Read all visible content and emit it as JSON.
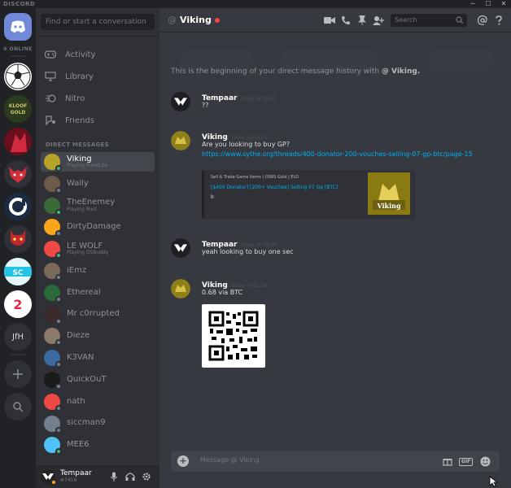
{
  "app": {
    "brand": "DISCORD"
  },
  "window": {
    "minimize": "─",
    "maximize": "☐",
    "close": "✕"
  },
  "rail": {
    "online_label": "0 ONLINE",
    "home_icon": "discord-logo-icon",
    "servers": [
      {
        "name": "server-ball",
        "color": "#ffffff"
      },
      {
        "name": "server-kloofgold",
        "color": "#2c3a1f"
      },
      {
        "name": "server-red-char",
        "color": "#a0152a"
      },
      {
        "name": "server-fox",
        "color": "#c0283a"
      },
      {
        "name": "server-ring",
        "color": "#1f6fc0"
      },
      {
        "name": "server-devil",
        "color": "#8b1a1a"
      },
      {
        "name": "server-sc",
        "color": "#22c3e6"
      },
      {
        "name": "server-two",
        "color": "#e6294b"
      }
    ],
    "text_server": "JfH",
    "add_icon": "plus-icon",
    "explore_icon": "search-icon"
  },
  "sidebar": {
    "search_placeholder": "Find or start a conversation",
    "nav": [
      {
        "label": "Activity",
        "icon": "gamepad-icon"
      },
      {
        "label": "Library",
        "icon": "library-icon"
      },
      {
        "label": "Nitro",
        "icon": "nitro-icon"
      },
      {
        "label": "Friends",
        "icon": "friends-icon"
      }
    ],
    "dm_header": "DIRECT MESSAGES",
    "dms": [
      {
        "name": "Viking",
        "sub": "Playing RuneLite",
        "color": "#b8a32a",
        "status": "#43b581",
        "active": true
      },
      {
        "name": "Wally",
        "sub": "",
        "color": "#6d5a4a",
        "status": "#747f8d"
      },
      {
        "name": "TheEnemey",
        "sub": "Playing Rust",
        "color": "#3a6a3a",
        "status": "#43b581"
      },
      {
        "name": "DirtyDamage",
        "sub": "",
        "color": "#faa61a",
        "status": "#747f8d"
      },
      {
        "name": "LE WOLF",
        "sub": "Playing OSBuddy",
        "color": "#f04747",
        "status": "#43b581"
      },
      {
        "name": "iEmz",
        "sub": "",
        "color": "#7a6a5a",
        "status": "#747f8d"
      },
      {
        "name": "Ethereal",
        "sub": "",
        "color": "#2a6a3a",
        "status": "#747f8d"
      },
      {
        "name": "Mr c0rrupted",
        "sub": "",
        "color": "#3a2a2a",
        "status": "#747f8d"
      },
      {
        "name": "Dieze",
        "sub": "",
        "color": "#8a7a6a",
        "status": "#747f8d"
      },
      {
        "name": "K3VAN",
        "sub": "",
        "color": "#3a6aa0",
        "status": "#747f8d"
      },
      {
        "name": "QuickOuT",
        "sub": "",
        "color": "#1a1a1a",
        "status": "#747f8d"
      },
      {
        "name": "nath",
        "sub": "",
        "color": "#f04747",
        "status": "#747f8d"
      },
      {
        "name": "siccman9",
        "sub": "",
        "color": "#747f8d",
        "status": "#747f8d"
      },
      {
        "name": "MEE6",
        "sub": "",
        "color": "#4fc3f7",
        "status": "#43b581"
      }
    ],
    "user": {
      "name": "Tempaar",
      "tag": "#7459"
    }
  },
  "chat": {
    "channel_name": "Viking",
    "search_placeholder": "Search",
    "beginning_text": "This is the beginning of your direct message history with",
    "beginning_user": "@ Viking.",
    "messages": [
      {
        "author": "Tempaar",
        "time": "Today at 05:51",
        "body": "??",
        "avatar": "#1e1f22"
      },
      {
        "author": "Viking",
        "time": "Today at 05:53",
        "body": "Are you looking to buy GP?",
        "link": "https://www.sythe.org/threads/400-donator-200-vouches-selling-07-gp-btc/page-15",
        "avatar": "#b8a32a"
      },
      {
        "author": "Tempaar",
        "time": "Today at 05:56",
        "body": "yeah looking to buy one sec",
        "avatar": "#1e1f22"
      },
      {
        "author": "Viking",
        "time": "Today at 05:59",
        "body": "0.68 via BTC",
        "avatar": "#b8a32a"
      }
    ],
    "embed": {
      "provider": "Sell & Trade Game Items | OSRS Gold | ELO",
      "title": "[$400 Donator] [200+ Vouches] Selling 07 Gp [BTC]",
      "description": "b",
      "thumb_label": "Viking"
    },
    "composer_placeholder": "Message @ Viking",
    "composer_gif": "GIF"
  }
}
